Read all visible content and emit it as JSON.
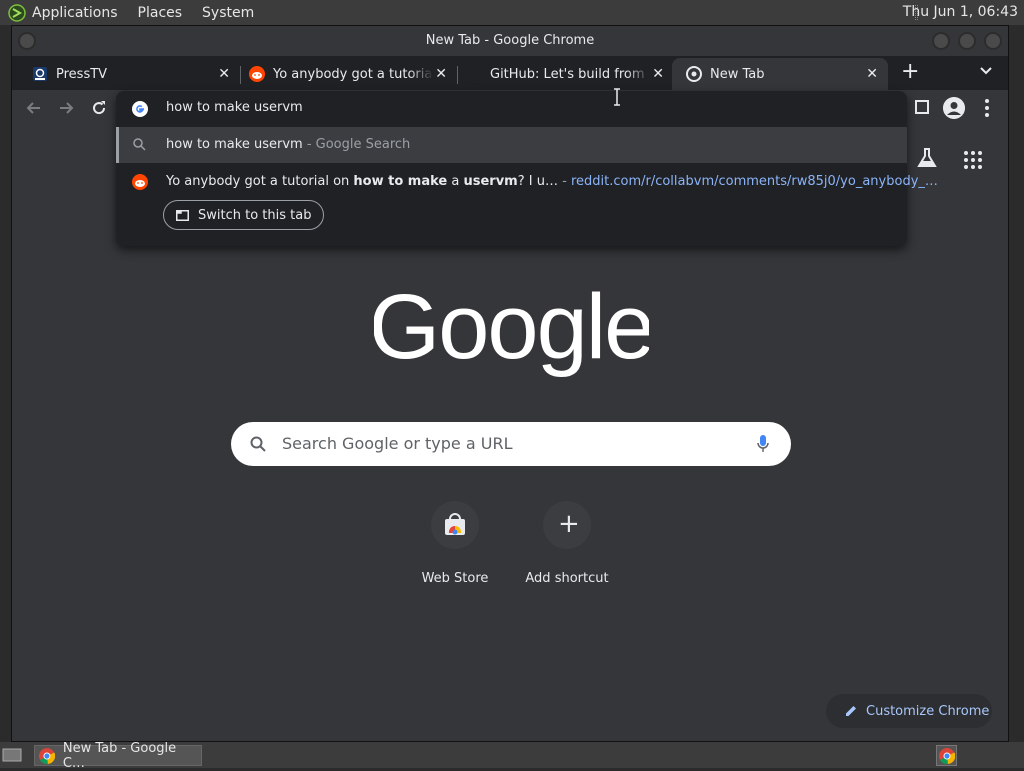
{
  "system_panel": {
    "menus": [
      "Applications",
      "Places",
      "System"
    ],
    "clock": "Thu Jun  1, 06:43"
  },
  "window": {
    "title": "New Tab - Google Chrome"
  },
  "tabs": [
    {
      "title": "PressTV",
      "icon": "presstv-icon"
    },
    {
      "title": "Yo anybody got a tutorial on how to make a uservm?",
      "icon": "reddit-icon"
    },
    {
      "title": "GitHub: Let's build from here",
      "icon": "github-icon"
    },
    {
      "title": "New Tab",
      "icon": "chrome-icon",
      "active": true
    }
  ],
  "omnibox": {
    "input_value": "how to make uservm",
    "suggestion_search": {
      "query": "how to make uservm",
      "suffix": " - Google Search"
    },
    "suggestion_tab": {
      "prefix": "Yo anybody got a tutorial on ",
      "bold1": "how to make",
      "mid": " a ",
      "bold2": "uservm",
      "rest": "? I u…",
      "dash": " - ",
      "url": "reddit.com/r/collabvm/comments/rw85j0/yo_anybody_…"
    },
    "switch_button": "Switch to this tab"
  },
  "ntp": {
    "logo_text": "Google",
    "search_placeholder": "Search Google or type a URL",
    "shortcuts": [
      {
        "label": "Web Store"
      },
      {
        "label": "Add shortcut"
      }
    ],
    "customize_label": "Customize Chrome"
  },
  "taskbar": {
    "item_label": "New Tab - Google C…"
  },
  "colors": {
    "accent_blue": "#8ab4f8",
    "reddit_orange": "#ff4500",
    "background": "#35363a"
  }
}
